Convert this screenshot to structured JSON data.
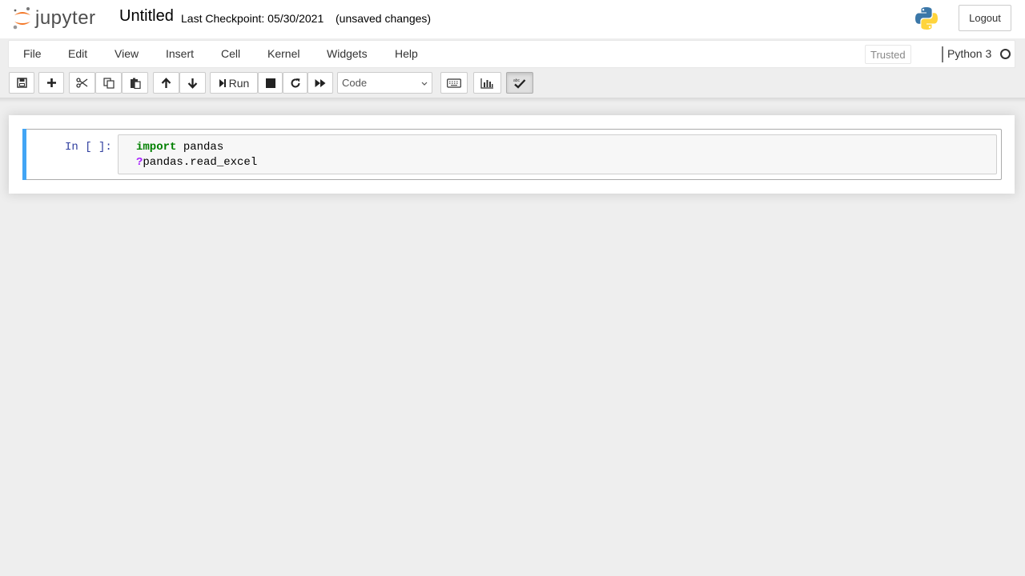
{
  "header": {
    "logo_text": "jupyter",
    "notebook_title": "Untitled",
    "checkpoint": "Last Checkpoint: 05/30/2021",
    "autosave_status": "(unsaved changes)",
    "logout_label": "Logout"
  },
  "menubar": {
    "items": [
      "File",
      "Edit",
      "View",
      "Insert",
      "Cell",
      "Kernel",
      "Widgets",
      "Help"
    ],
    "trusted_label": "Trusted",
    "kernel_name": "Python 3"
  },
  "toolbar": {
    "run_label": "Run",
    "cell_type": "Code",
    "icons": [
      "save-icon",
      "plus-icon",
      "cut-icon",
      "copy-icon",
      "paste-icon",
      "arrow-up-icon",
      "arrow-down-icon",
      "step-forward-icon",
      "stop-icon",
      "refresh-icon",
      "fast-forward-icon",
      "keyboard-icon",
      "bar-chart-icon",
      "spellcheck-icon"
    ]
  },
  "cell": {
    "prompt": "In [ ]:",
    "code_line1_keyword": "import",
    "code_line1_rest": " pandas",
    "code_line2_op": "?",
    "code_line2_rest": "pandas.read_excel"
  },
  "colors": {
    "accent_bar": "#42a5f5",
    "prompt_color": "#303f9f",
    "keyword_color": "#008000",
    "operator_color": "#aa22ff",
    "jupyter_orange": "#f37726"
  }
}
